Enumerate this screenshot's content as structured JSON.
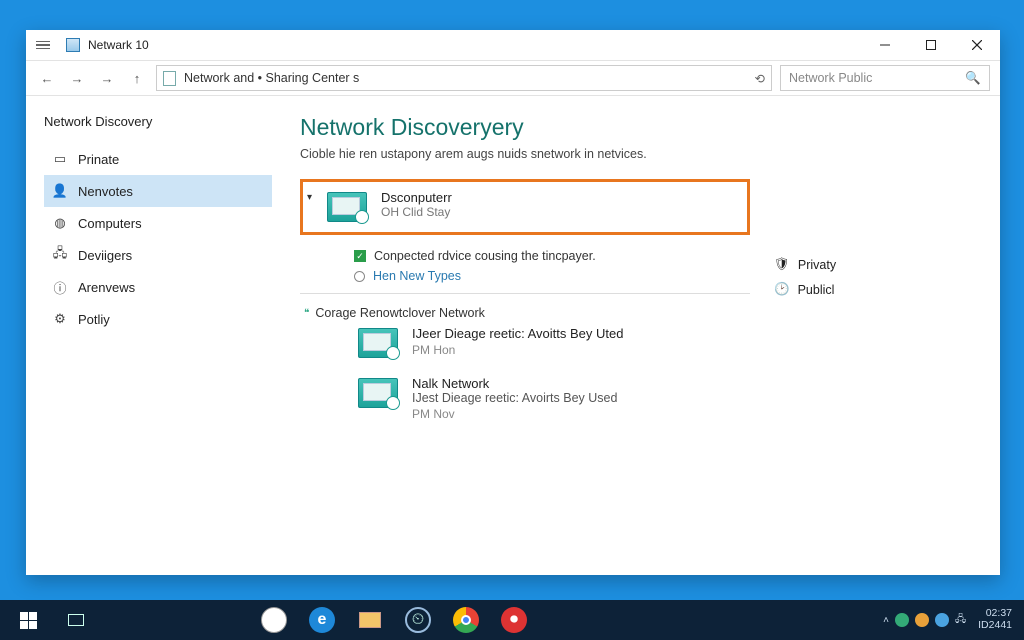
{
  "window": {
    "title": "Netwark 10"
  },
  "toolbar": {
    "address": "Network and • Sharing Center s",
    "search_placeholder": "Network Public"
  },
  "sidebar": {
    "heading": "Network Discovery",
    "items": [
      {
        "label": "Prinate"
      },
      {
        "label": "Nenvotes"
      },
      {
        "label": "Computers"
      },
      {
        "label": "Deviigers"
      },
      {
        "label": "Arenvews"
      },
      {
        "label": "Potliy"
      }
    ]
  },
  "main": {
    "title": "Network Discoveryery",
    "subtitle": "Cioble hie ren ustapony arem augs nuids snetwork in netvices.",
    "highlight": {
      "name": "Dsconputerr",
      "sub": "OH Clid Stay"
    },
    "check_text": "Conpected rdvice cousing the tincpayer.",
    "link_text": "Hen New Types",
    "section_label": "Corage Renowtclover Network",
    "items": [
      {
        "title": "IJeer Dieage reetic: Avoitts Bey Uted",
        "time": "PM Hon"
      },
      {
        "title": "Nalk Network",
        "sub": "IJest Dieage reetic: Avoirts Bey Used",
        "time": "PM Nov"
      }
    ]
  },
  "right": {
    "privacy": "Privaty",
    "public": "Publicl"
  },
  "taskbar": {
    "time": "02:37",
    "label2": "ID2441"
  }
}
